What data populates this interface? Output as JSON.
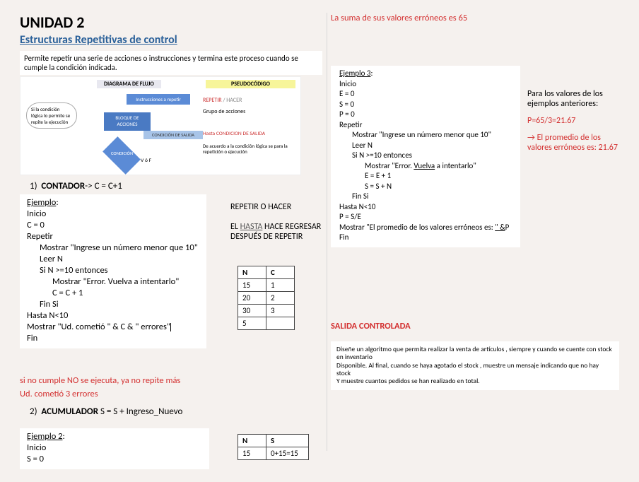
{
  "unit_title": "UNIDAD 2",
  "subtitle": "Estructuras Repetitivas de control",
  "intro": "Permite repetir una serie de acciones o instrucciones y termina este proceso cuando se cumple la condición indicada.",
  "diagram": {
    "title_left": "DIAGRAMA DE FLUJO",
    "title_right": "PSEUDOCÓDIGO",
    "cloud1": "Si la condición lógica lo permite se repite la ejecución",
    "cloud2": "",
    "instr": "Instrucciones a repetir",
    "block": "BLOQUE DE ACCIONES",
    "cond_sal": "CONDICIÓN DE SALIDA",
    "cond": "CONDICIÓN",
    "vf": "V ó F",
    "pseudo_repeat": "REPETIR",
    "pseudo_hacer": " / HACER",
    "pseudo_group": "Grupo de acciones",
    "pseudo_hasta": "Hasta ",
    "pseudo_cond": "CONDICION DE SALIDA",
    "pseudo_desc": "De acuerdo a la condición lógica se para la repetición o ejecución"
  },
  "contador_title_n": "1)",
  "contador_title": "CONTADOR",
  "contador_expr": "-> C = C+1",
  "ex1": {
    "label": "Ejemplo",
    "l1": "Inicio",
    "l2": "C = 0",
    "l3": "Repetir",
    "l4": "Mostrar \"Ingrese un número menor que 10\"",
    "l5": "Leer N",
    "l6": "Si N >=10 entonces",
    "l7": "Mostrar \"Error. Vuelva a intentarlo\"",
    "l8": "C = C + 1",
    "l9": "Fin Si",
    "l10": "Hasta N<10",
    "l11": "Mostrar \"Ud. cometió \" & C & \" errores\"",
    "l12": "Fin"
  },
  "repeat_h": "REPETIR O HACER",
  "repeat_p": "EL ",
  "repeat_hasta": "HASTA",
  "repeat_p2": " HACE REGRESAR DESPUÉS DE REPETIR",
  "table1": {
    "hN": "N",
    "hC": "C",
    "rows": [
      {
        "n": "15",
        "c": "1"
      },
      {
        "n": "20",
        "c": "2"
      },
      {
        "n": "30",
        "c": "3"
      },
      {
        "n": "5",
        "c": ""
      }
    ]
  },
  "note1": "si no cumple NO se ejecuta, ya no repite más",
  "note2": "Ud. cometió 3 errores",
  "acum_title_n": "2)",
  "acum_title": "ACUMULADOR",
  "acum_expr": " S = S + Ingreso_Nuevo",
  "ex2": {
    "label": "Ejemplo 2",
    "l1": "Inicio",
    "l2": "S = 0"
  },
  "table2": {
    "hN": "N",
    "hS": "S",
    "rows": [
      {
        "n": "15",
        "s": "0+15=15"
      }
    ]
  },
  "sum_top": "La suma de sus valores erróneos es 65",
  "ex3": {
    "label": "Ejemplo 3",
    "l1": "Inicio",
    "l2": "E = 0",
    "l3": "S = 0",
    "l4": "P = 0",
    "l5": "Repetir",
    "l6": "Mostrar \"Ingrese un número menor que 10\"",
    "l7": "Leer N",
    "l8": "Si N >=10 entonces",
    "l9a": "Mostrar \"Error. ",
    "l9b": "Vuelva",
    "l9c": " a intentarlo\"",
    "l10": "E = E + 1",
    "l11": "S = S + N",
    "l12": "Fin Si",
    "l13": "Hasta N<10",
    "l14": "P = S/E",
    "l15a": "Mostrar \"El promedio de los valores erróneos es: ",
    "l15b": "\" &",
    "l15c": "P",
    "l16": "Fin"
  },
  "right": {
    "para": "Para los valores de los ejemplos anteriores:",
    "calc": "P=65/3=21.67",
    "prom": "→ El promedio de los valores erróneos es: 21.67"
  },
  "salida": "SALIDA CONTROLADA",
  "prob": {
    "l1": "Diseñe un algoritmo que permita realizar la venta de artículos , siempre y cuando se cuente con stock en inventario",
    "l2": "Disponible. Al final, cuando se haya agotado el stock , muestre un mensaje indicando que no hay stock",
    "l3": "Y muestre cuantos pedidos se han realizado en total."
  }
}
